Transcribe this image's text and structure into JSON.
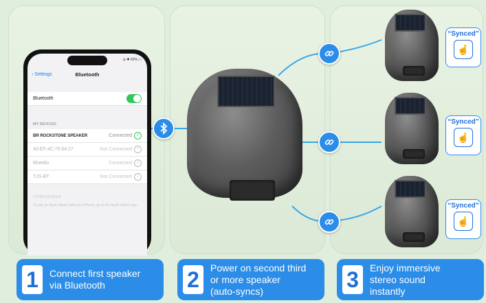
{
  "phone": {
    "status_time": "",
    "status_right": "◎ ✱ 63% ▭",
    "back_label": "Settings",
    "nav_title": "Bluetooth",
    "bluetooth_label": "Bluetooth",
    "bluetooth_on": true,
    "my_devices_header": "MY DEVICES",
    "devices": [
      {
        "name": "BR ROCKSTONE  SPEAKER",
        "status": "Connected"
      },
      {
        "name": "40:EF:4C:75:64:27",
        "status": "Not Connected"
      },
      {
        "name": "Bluedio",
        "status": "Connected"
      },
      {
        "name": "TJS-BT",
        "status": "Not Connected"
      }
    ],
    "other_devices_header": "OTHER DEVICES",
    "hint_text": "To pair an Apple Watch with your iPhone, go to the Apple Watch app."
  },
  "synced_label": "“Synced”",
  "icons": {
    "bluetooth": "bluetooth-icon",
    "link": "link-icon",
    "touch": "tap-hand-icon"
  },
  "steps": [
    {
      "number": "1",
      "text_line1": "Connect first speaker",
      "text_line2": "via Bluetooth",
      "text_line3": ""
    },
    {
      "number": "2",
      "text_line1": "Power on second third",
      "text_line2": "or more speaker",
      "text_line3": "(auto-syncs)"
    },
    {
      "number": "3",
      "text_line1": "Enjoy immersive",
      "text_line2": "stereo sound",
      "text_line3": "instantly"
    }
  ],
  "colors": {
    "accent": "#2b8de8",
    "connected": "#34c759"
  }
}
